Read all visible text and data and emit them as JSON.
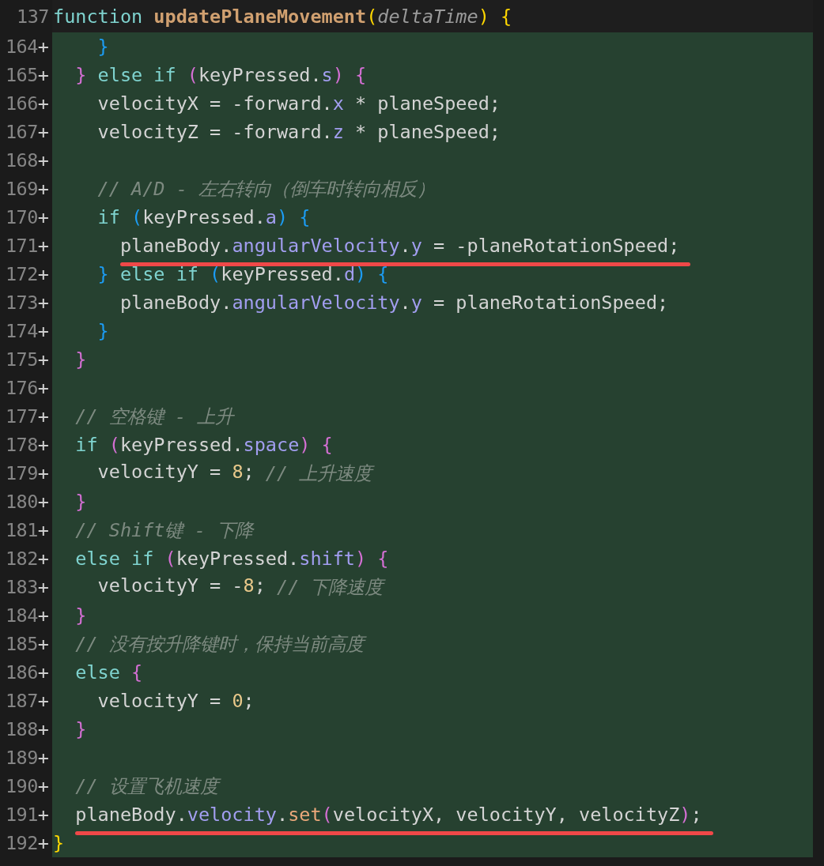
{
  "lines": [
    {
      "number": "137",
      "added": false,
      "underlined": false,
      "tokens": [
        {
          "kind": "kw",
          "text": "function "
        },
        {
          "kind": "fn",
          "text": "updatePlaneMovement"
        },
        {
          "kind": "b1",
          "text": "("
        },
        {
          "kind": "param",
          "text": "deltaTime"
        },
        {
          "kind": "b1",
          "text": ")"
        },
        {
          "kind": "b1",
          "text": " {"
        }
      ]
    },
    {
      "number": "164",
      "marker": "+",
      "added": true,
      "underlined": false,
      "tokens": [
        {
          "kind": "b3",
          "text": "    }"
        }
      ]
    },
    {
      "number": "165",
      "marker": "+",
      "added": true,
      "underlined": false,
      "tokens": [
        {
          "kind": "b2",
          "text": "  }"
        },
        {
          "kind": "kw",
          "text": " else if "
        },
        {
          "kind": "b2",
          "text": "("
        },
        {
          "kind": "plain",
          "text": "keyPressed."
        },
        {
          "kind": "prop",
          "text": "s"
        },
        {
          "kind": "b2",
          "text": ")"
        },
        {
          "kind": "b2",
          "text": " {"
        }
      ]
    },
    {
      "number": "166",
      "marker": "+",
      "added": true,
      "underlined": false,
      "tokens": [
        {
          "kind": "plain",
          "text": "    velocityX = -forward."
        },
        {
          "kind": "prop",
          "text": "x"
        },
        {
          "kind": "plain",
          "text": " * planeSpeed;"
        }
      ]
    },
    {
      "number": "167",
      "marker": "+",
      "added": true,
      "underlined": false,
      "tokens": [
        {
          "kind": "plain",
          "text": "    velocityZ = -forward."
        },
        {
          "kind": "prop",
          "text": "z"
        },
        {
          "kind": "plain",
          "text": " * planeSpeed;"
        }
      ]
    },
    {
      "number": "168",
      "marker": "+",
      "added": true,
      "underlined": false
    },
    {
      "number": "169",
      "marker": "+",
      "added": true,
      "underlined": false,
      "tokens": [
        {
          "kind": "cmt",
          "text": "    // A/D - 左右转向（倒车时转向相反）"
        }
      ]
    },
    {
      "number": "170",
      "marker": "+",
      "added": true,
      "underlined": false,
      "tokens": [
        {
          "kind": "kw",
          "text": "    if "
        },
        {
          "kind": "b3",
          "text": "("
        },
        {
          "kind": "plain",
          "text": "keyPressed."
        },
        {
          "kind": "prop",
          "text": "a"
        },
        {
          "kind": "b3",
          "text": ")"
        },
        {
          "kind": "b3",
          "text": " {"
        }
      ]
    },
    {
      "number": "171",
      "marker": "+",
      "added": true,
      "underlined": true,
      "tokens": [
        {
          "kind": "plain",
          "text": "      planeBody."
        },
        {
          "kind": "prop",
          "text": "angularVelocity"
        },
        {
          "kind": "plain",
          "text": "."
        },
        {
          "kind": "prop",
          "text": "y"
        },
        {
          "kind": "plain",
          "text": " = -planeRotationSpeed;"
        }
      ]
    },
    {
      "number": "172",
      "marker": "+",
      "added": true,
      "underlined": false,
      "tokens": [
        {
          "kind": "b3",
          "text": "    }"
        },
        {
          "kind": "kw",
          "text": " else if "
        },
        {
          "kind": "b3",
          "text": "("
        },
        {
          "kind": "plain",
          "text": "keyPressed."
        },
        {
          "kind": "prop",
          "text": "d"
        },
        {
          "kind": "b3",
          "text": ")"
        },
        {
          "kind": "b3",
          "text": " {"
        }
      ]
    },
    {
      "number": "173",
      "marker": "+",
      "added": true,
      "underlined": false,
      "tokens": [
        {
          "kind": "plain",
          "text": "      planeBody."
        },
        {
          "kind": "prop",
          "text": "angularVelocity"
        },
        {
          "kind": "plain",
          "text": "."
        },
        {
          "kind": "prop",
          "text": "y"
        },
        {
          "kind": "plain",
          "text": " = planeRotationSpeed;"
        }
      ]
    },
    {
      "number": "174",
      "marker": "+",
      "added": true,
      "underlined": false,
      "tokens": [
        {
          "kind": "b3",
          "text": "    }"
        }
      ]
    },
    {
      "number": "175",
      "marker": "+",
      "added": true,
      "underlined": false,
      "tokens": [
        {
          "kind": "b2",
          "text": "  }"
        }
      ]
    },
    {
      "number": "176",
      "marker": "+",
      "added": true,
      "underlined": false
    },
    {
      "number": "177",
      "marker": "+",
      "added": true,
      "underlined": false,
      "tokens": [
        {
          "kind": "cmt",
          "text": "  // 空格键 - 上升"
        }
      ]
    },
    {
      "number": "178",
      "marker": "+",
      "added": true,
      "underlined": false,
      "tokens": [
        {
          "kind": "kw",
          "text": "  if "
        },
        {
          "kind": "b2",
          "text": "("
        },
        {
          "kind": "plain",
          "text": "keyPressed."
        },
        {
          "kind": "prop",
          "text": "space"
        },
        {
          "kind": "b2",
          "text": ")"
        },
        {
          "kind": "b2",
          "text": " {"
        }
      ]
    },
    {
      "number": "179",
      "marker": "+",
      "added": true,
      "underlined": false,
      "tokens": [
        {
          "kind": "plain",
          "text": "    velocityY = "
        },
        {
          "kind": "num",
          "text": "8"
        },
        {
          "kind": "plain",
          "text": "; "
        },
        {
          "kind": "cmt",
          "text": "// 上升速度"
        }
      ]
    },
    {
      "number": "180",
      "marker": "+",
      "added": true,
      "underlined": false,
      "tokens": [
        {
          "kind": "b2",
          "text": "  }"
        }
      ]
    },
    {
      "number": "181",
      "marker": "+",
      "added": true,
      "underlined": false,
      "tokens": [
        {
          "kind": "cmt",
          "text": "  // Shift键 - 下降"
        }
      ]
    },
    {
      "number": "182",
      "marker": "+",
      "added": true,
      "underlined": false,
      "tokens": [
        {
          "kind": "kw",
          "text": "  else if "
        },
        {
          "kind": "b2",
          "text": "("
        },
        {
          "kind": "plain",
          "text": "keyPressed."
        },
        {
          "kind": "prop",
          "text": "shift"
        },
        {
          "kind": "b2",
          "text": ")"
        },
        {
          "kind": "b2",
          "text": " {"
        }
      ]
    },
    {
      "number": "183",
      "marker": "+",
      "added": true,
      "underlined": false,
      "tokens": [
        {
          "kind": "plain",
          "text": "    velocityY = -"
        },
        {
          "kind": "num",
          "text": "8"
        },
        {
          "kind": "plain",
          "text": "; "
        },
        {
          "kind": "cmt",
          "text": "// 下降速度"
        }
      ]
    },
    {
      "number": "184",
      "marker": "+",
      "added": true,
      "underlined": false,
      "tokens": [
        {
          "kind": "b2",
          "text": "  }"
        }
      ]
    },
    {
      "number": "185",
      "marker": "+",
      "added": true,
      "underlined": false,
      "tokens": [
        {
          "kind": "cmt",
          "text": "  // 没有按升降键时，保持当前高度"
        }
      ]
    },
    {
      "number": "186",
      "marker": "+",
      "added": true,
      "underlined": false,
      "tokens": [
        {
          "kind": "kw",
          "text": "  else "
        },
        {
          "kind": "b2",
          "text": "{"
        }
      ]
    },
    {
      "number": "187",
      "marker": "+",
      "added": true,
      "underlined": false,
      "tokens": [
        {
          "kind": "plain",
          "text": "    velocityY = "
        },
        {
          "kind": "num",
          "text": "0"
        },
        {
          "kind": "plain",
          "text": ";"
        }
      ]
    },
    {
      "number": "188",
      "marker": "+",
      "added": true,
      "underlined": false,
      "tokens": [
        {
          "kind": "b2",
          "text": "  }"
        }
      ]
    },
    {
      "number": "189",
      "marker": "+",
      "added": true,
      "underlined": false
    },
    {
      "number": "190",
      "marker": "+",
      "added": true,
      "underlined": false,
      "tokens": [
        {
          "kind": "cmt",
          "text": "  // 设置飞机速度"
        }
      ]
    },
    {
      "number": "191",
      "marker": "+",
      "added": true,
      "underlined": true,
      "tokens": [
        {
          "kind": "plain",
          "text": "  planeBody."
        },
        {
          "kind": "prop",
          "text": "velocity"
        },
        {
          "kind": "plain",
          "text": "."
        },
        {
          "kind": "method",
          "text": "set"
        },
        {
          "kind": "b2",
          "text": "("
        },
        {
          "kind": "plain",
          "text": "velocityX, velocityY, velocityZ"
        },
        {
          "kind": "b2",
          "text": ")"
        },
        {
          "kind": "plain",
          "text": ";"
        }
      ]
    },
    {
      "number": "192",
      "marker": "+",
      "added": true,
      "underlined": false,
      "tokens": [
        {
          "kind": "b1",
          "text": "}"
        }
      ]
    }
  ]
}
